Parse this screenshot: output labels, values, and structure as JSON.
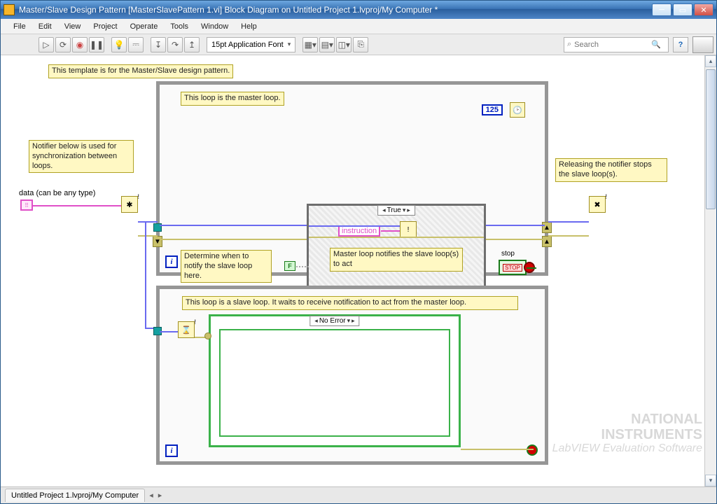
{
  "window": {
    "title": "Master/Slave Design Pattern [MasterSlavePattern 1.vi] Block Diagram on Untitled Project 1.lvproj/My Computer *"
  },
  "menu": [
    "File",
    "Edit",
    "View",
    "Project",
    "Operate",
    "Tools",
    "Window",
    "Help"
  ],
  "toolbar": {
    "font": "15pt Application Font",
    "search_placeholder": "Search"
  },
  "labels": {
    "template": "This template is for the Master/Slave design pattern.",
    "master_loop": "This loop is the master loop.",
    "timing_const": "125",
    "notifier_desc": "Notifier below is used for synchronization between loops.",
    "data_terminal": "data (can be any type)",
    "determine": "Determine when to notify the slave loop here.",
    "case_true": "True",
    "instruction": "instruction",
    "master_notifies": "Master loop notifies the slave loop(s) to act",
    "stop": "stop",
    "stop_inner": "STOP",
    "releasing": "Releasing the notifier stops the slave loop(s).",
    "slave_loop": "This loop is a slave loop. It waits to receive notification to act from the master loop.",
    "case_noerror": "No Error",
    "false_const": "F"
  },
  "status": {
    "path": "Untitled Project 1.lvproj/My Computer"
  },
  "watermark": {
    "brand1": "NATIONAL",
    "brand2": "INSTRUMENTS",
    "sub": "LabVIEW Evaluation Software"
  }
}
